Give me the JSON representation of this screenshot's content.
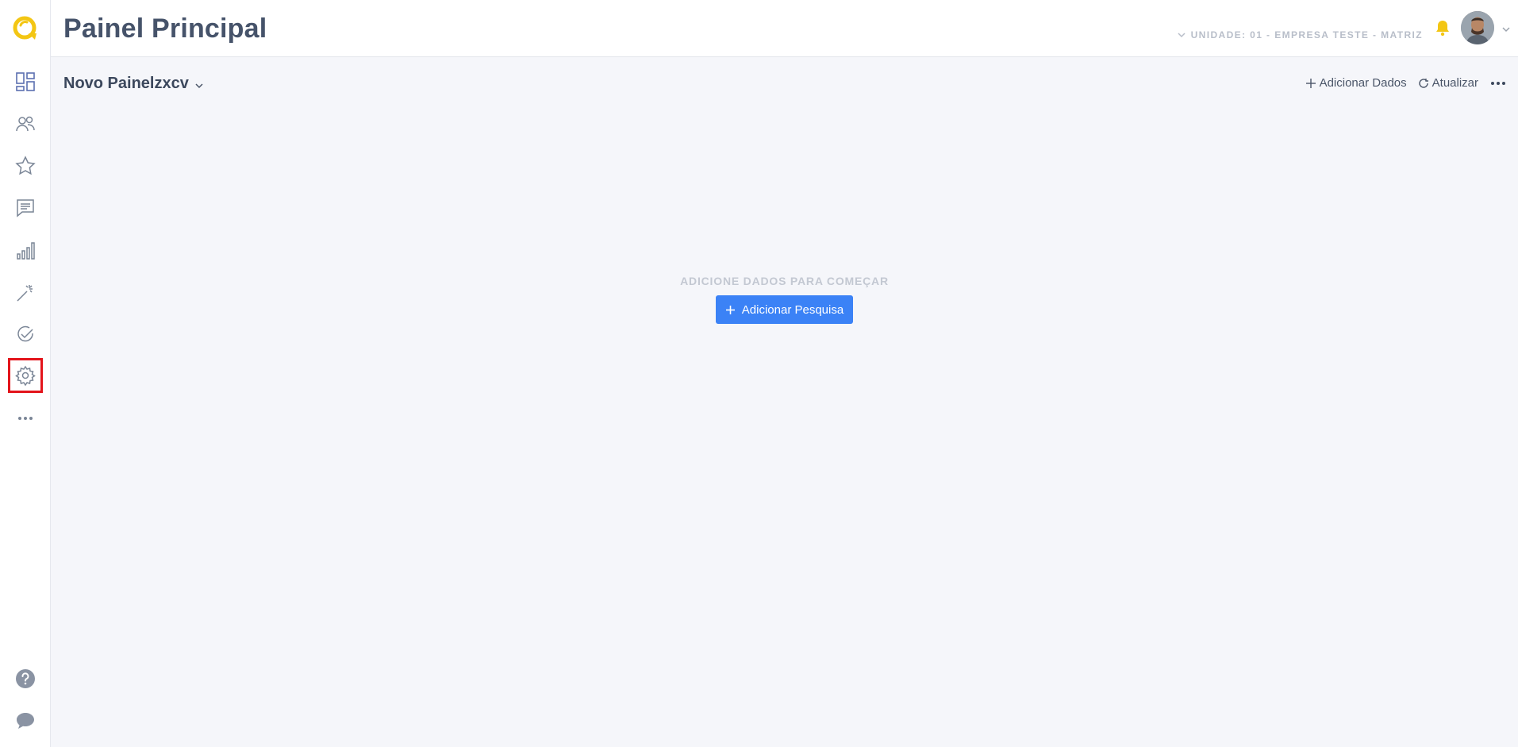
{
  "header": {
    "title": "Painel Principal",
    "unit_label": "UNIDADE: 01 - EMPRESA TESTE - MATRIZ"
  },
  "board": {
    "name": "Novo Painelzxcv"
  },
  "toolbar": {
    "add_data_label": "Adicionar Dados",
    "refresh_label": "Atualizar"
  },
  "empty_state": {
    "message": "ADICIONE DADOS PARA COMEÇAR",
    "button_label": "Adicionar Pesquisa"
  },
  "sidebar": {
    "items": [
      {
        "icon": "dashboard-icon"
      },
      {
        "icon": "users-icon"
      },
      {
        "icon": "star-icon"
      },
      {
        "icon": "messages-icon"
      },
      {
        "icon": "bar-chart-icon"
      },
      {
        "icon": "magic-wand-icon"
      },
      {
        "icon": "check-circle-icon"
      },
      {
        "icon": "gear-icon",
        "highlighted": true
      },
      {
        "icon": "more-horizontal-icon"
      }
    ],
    "bottom": [
      {
        "icon": "help-icon"
      },
      {
        "icon": "chat-icon"
      }
    ]
  },
  "colors": {
    "brand_yellow": "#f3c614",
    "primary_blue": "#3b82f6",
    "highlight_red": "#e3141b"
  }
}
